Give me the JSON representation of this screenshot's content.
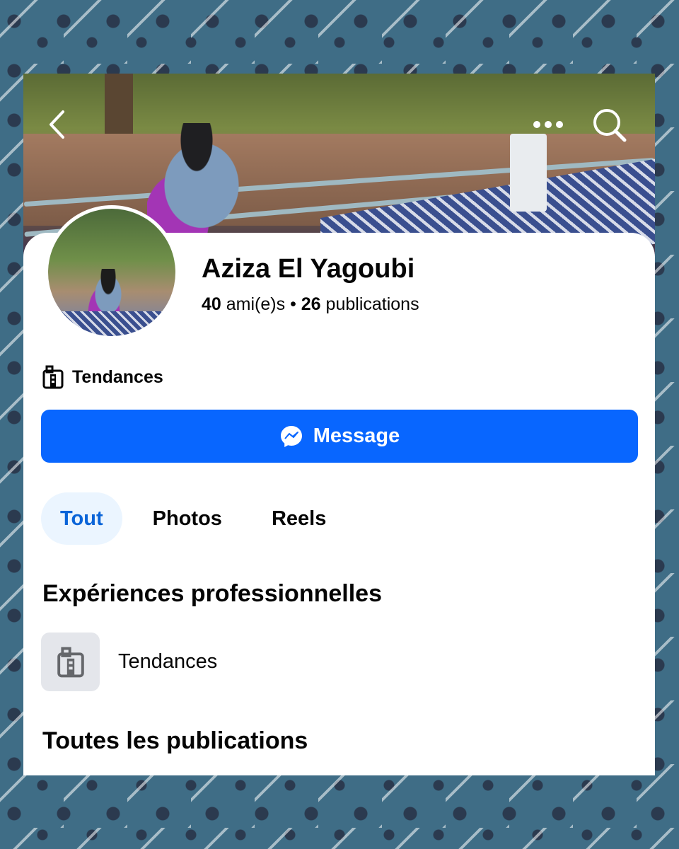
{
  "profile": {
    "name": "Aziza El Yagoubi",
    "friends_count": "40",
    "friends_label": "ami(e)s",
    "separator": "•",
    "posts_count": "26",
    "posts_label": "publications",
    "category": "Tendances"
  },
  "actions": {
    "message_label": "Message"
  },
  "tabs": [
    {
      "label": "Tout",
      "active": true
    },
    {
      "label": "Photos",
      "active": false
    },
    {
      "label": "Reels",
      "active": false
    }
  ],
  "sections": {
    "experience_title": "Expériences professionnelles",
    "experience_item": "Tendances",
    "posts_title": "Toutes les publications"
  },
  "colors": {
    "accent": "#0866ff",
    "active_tab_bg": "#ebf5ff",
    "active_tab_text": "#0a64d8",
    "frame_background": "#3f6d86"
  },
  "icons": [
    "back-chevron-icon",
    "more-dots-icon",
    "search-icon",
    "building-icon",
    "messenger-icon"
  ]
}
